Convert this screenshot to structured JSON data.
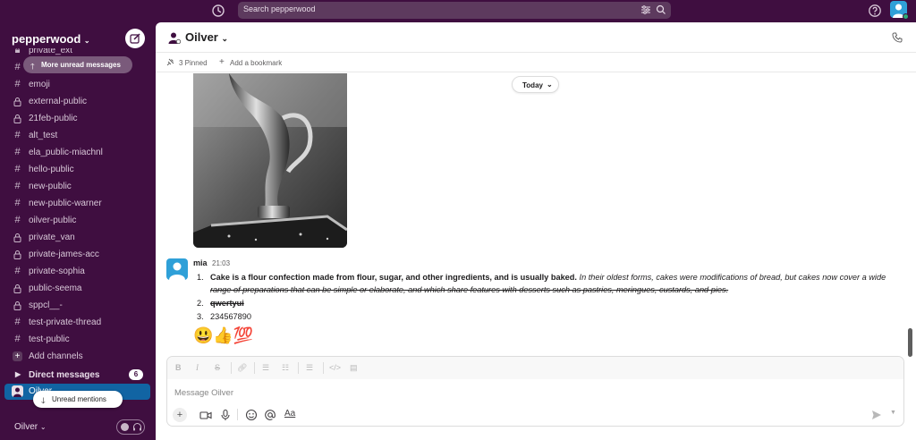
{
  "search": {
    "placeholder": "Search pepperwood"
  },
  "workspace": {
    "name": "pepperwood"
  },
  "sidebar": {
    "unread_pill": "More unread messages",
    "channels": [
      {
        "type": "lock",
        "label": "private_ext"
      },
      {
        "type": "hash",
        "label": ""
      },
      {
        "type": "hash",
        "label": "emoji"
      },
      {
        "type": "lock",
        "label": "external-public"
      },
      {
        "type": "lock",
        "label": "21feb-public"
      },
      {
        "type": "hash",
        "label": "alt_test"
      },
      {
        "type": "hash",
        "label": "ela_public-miachnl"
      },
      {
        "type": "hash",
        "label": "hello-public"
      },
      {
        "type": "hash",
        "label": "new-public"
      },
      {
        "type": "hash",
        "label": "new-public-warner"
      },
      {
        "type": "hash",
        "label": "oilver-public"
      },
      {
        "type": "lock",
        "label": "private_van"
      },
      {
        "type": "lock",
        "label": "private-james-acc"
      },
      {
        "type": "hash",
        "label": "private-sophia"
      },
      {
        "type": "lock",
        "label": "public-seema"
      },
      {
        "type": "lock",
        "label": "sppcl__-"
      },
      {
        "type": "hash",
        "label": "test-private-thread"
      },
      {
        "type": "hash",
        "label": "test-public"
      },
      {
        "type": "plus",
        "label": "Add channels"
      }
    ],
    "dm_header": "Direct messages",
    "dm_count": "6",
    "dm_active": "Oilver",
    "mentions_pill": "Unread mentions",
    "user": "Oilver"
  },
  "channel": {
    "name": "Oilver",
    "pinned": "3 Pinned",
    "add_bookmark": "Add a bookmark",
    "date_divider": "Today"
  },
  "message": {
    "author": "mia",
    "time": "21:03",
    "items": [
      {
        "num": "1.",
        "bold": "Cake is a flour confection made from flour, sugar, and other ingredients, and is usually baked.",
        "italic": "In their oldest forms, cakes were modifications of bread, but cakes now cover a wide",
        "strike": "range of preparations that can be simple or elaborate, and which share features with desserts such as pastries, meringues, custards, and pies."
      },
      {
        "num": "2.",
        "text": "qwertyui"
      },
      {
        "num": "3.",
        "text": "234567890"
      }
    ],
    "reactions": "😃👍💯"
  },
  "composer": {
    "placeholder": "Message Oilver"
  },
  "colors": {
    "aubergine": "#3f0e40",
    "active_blue": "#1164a3",
    "avatar_blue": "#2fa0d8",
    "online_green": "#2bac76"
  }
}
